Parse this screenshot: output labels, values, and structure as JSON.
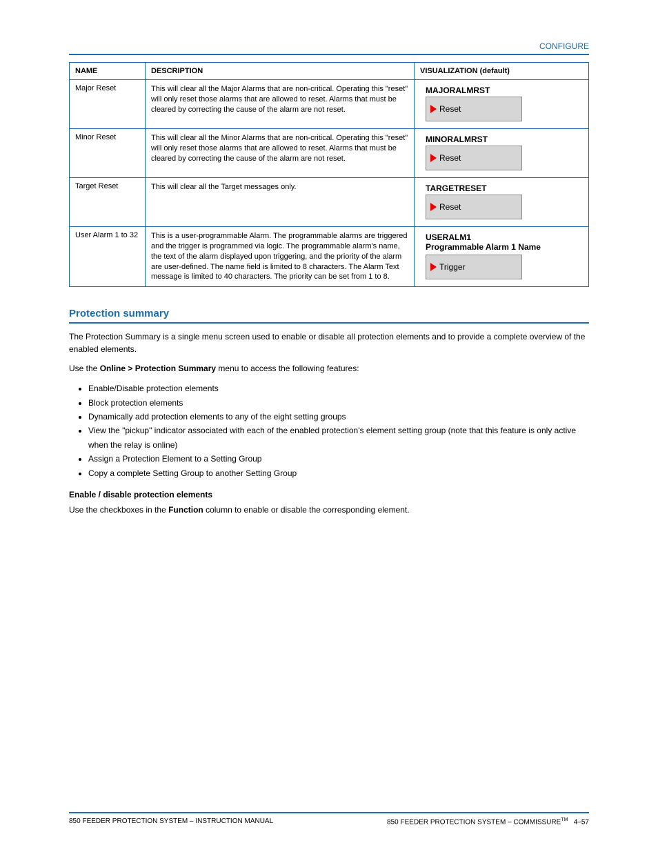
{
  "header": {
    "right": "CONFIGURE"
  },
  "table": {
    "columns": [
      "NAME",
      "DESCRIPTION",
      "VISUALIZATION (default)"
    ],
    "rows": [
      {
        "name": "Major Reset",
        "desc": "This will clear all the Major Alarms that are non-critical. Operating this \"reset\" will only reset those alarms that are allowed to reset. Alarms that must be cleared by correcting the cause of the alarm are not reset.",
        "vis_title": "MAJORALMRST",
        "vis_btn": "Reset"
      },
      {
        "name": "Minor Reset",
        "desc": "This will clear all the Minor Alarms that are non-critical. Operating this \"reset\" will only reset those alarms that are allowed to reset. Alarms that must be cleared by correcting the cause of the alarm are not reset.",
        "vis_title": "MINORALMRST",
        "vis_btn": "Reset"
      },
      {
        "name": "Target Reset",
        "desc": "This will clear all the Target messages only.",
        "vis_title": "TARGETRESET",
        "vis_btn": "Reset"
      },
      {
        "name": "User Alarm 1 to 32",
        "desc": "This is a user-programmable Alarm. The programmable alarms are triggered and the trigger is programmed via logic. The programmable alarm's name, the text of the alarm displayed upon triggering, and the priority of the alarm are user-defined. The name field is limited to 8 characters. The Alarm Text message is limited to 40 characters. The priority can be set from 1 to 8.",
        "vis_title": "USERALM1",
        "vis_sub": "Programmable Alarm 1 Name",
        "vis_btn": "Trigger"
      }
    ]
  },
  "section": {
    "title": "Protection summary",
    "p1": "The Protection Summary is a single menu screen used to enable or disable all protection elements and to provide a complete overview of the enabled elements.",
    "p2_a": "Use the ",
    "p2_b": "Online > Protection Summary",
    "p2_c": " menu to access the following features:",
    "bullets": [
      "Enable/Disable protection elements",
      "Block protection elements",
      "Dynamically add protection elements to any of the eight setting groups",
      "View the \"pickup\" indicator associated with each of the enabled protection's element setting group (note that this feature is only active when the relay is online)",
      "Assign a Protection Element to a Setting Group",
      "Copy a complete Setting Group to another Setting Group"
    ]
  },
  "sub": {
    "title": "Enable / disable protection elements",
    "p_a": "Use the checkboxes in the ",
    "p_b": "Function",
    "p_c": " column to enable or disable the corresponding element."
  },
  "footer": {
    "left": "850 FEEDER PROTECTION SYSTEM – INSTRUCTION MANUAL",
    "right_a": "850 FEEDER PROTECTION SYSTEM – COMMISSURE",
    "right_b": "4–57"
  }
}
